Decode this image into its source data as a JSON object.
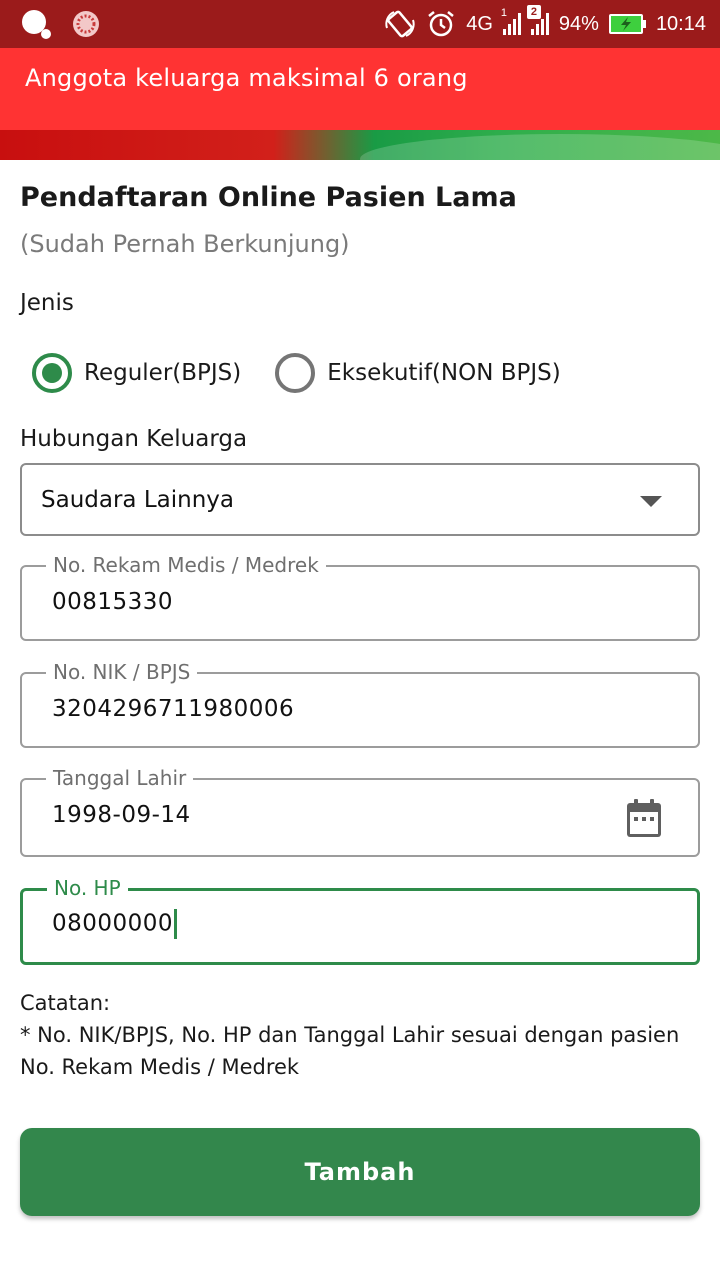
{
  "status_bar": {
    "network": "4G",
    "sim1_label": "1",
    "sim2_label": "2",
    "battery": "94%",
    "time": "10:14"
  },
  "alert": {
    "message": "Anggota keluarga maksimal 6 orang"
  },
  "colors": {
    "status_bar": "#9b1b1b",
    "alert": "#ff3333",
    "accent_green": "#2e8b4a",
    "button": "#33874c"
  },
  "form": {
    "title": "Pendaftaran Online Pasien Lama",
    "subtitle": "(Sudah Pernah Berkunjung)",
    "jenis_label": "Jenis",
    "jenis_options": [
      {
        "label": "Reguler(BPJS)",
        "selected": true
      },
      {
        "label": "Eksekutif(NON BPJS)",
        "selected": false
      }
    ],
    "hubungan_label": "Hubungan Keluarga",
    "hubungan_value": "Saudara Lainnya",
    "fields": {
      "medrek": {
        "label": "No. Rekam Medis / Medrek",
        "value": "00815330"
      },
      "nik": {
        "label": "No. NIK / BPJS",
        "value": "3204296711980006"
      },
      "tanggal_lahir": {
        "label": "Tanggal Lahir",
        "value": "1998-09-14",
        "icon": "calendar-icon"
      },
      "hp": {
        "label": "No. HP",
        "value": "08000000"
      }
    },
    "note_title": "Catatan:",
    "note_line1": "* No. NIK/BPJS, No. HP dan Tanggal Lahir sesuai dengan pasien",
    "note_line2": "No. Rekam Medis / Medrek",
    "submit_label": "Tambah"
  }
}
